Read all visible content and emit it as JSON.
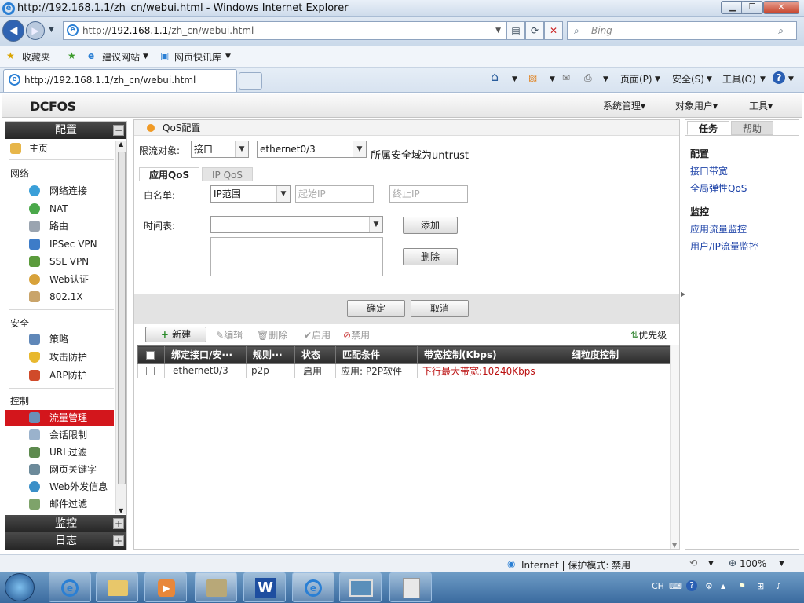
{
  "window": {
    "title": "http://192.168.1.1/zh_cn/webui.html - Windows Internet Explorer"
  },
  "address": {
    "prefix": "http://",
    "host": "192.168.1.1",
    "path": "/zh_cn/webui.html"
  },
  "search": {
    "placeholder": "Bing"
  },
  "favorites": {
    "label": "收藏夹",
    "items": [
      "建议网站",
      "网页快讯库"
    ]
  },
  "tab": {
    "title": "http://192.168.1.1/zh_cn/webui.html"
  },
  "commands": [
    "页面(P)",
    "安全(S)",
    "工具(O)"
  ],
  "app": {
    "logo": "DCFOS",
    "top_menu": [
      "系统管理",
      "对象用户",
      "工具"
    ]
  },
  "sidebar": {
    "header": "配置",
    "home": "主页",
    "sections": [
      {
        "title": "网络",
        "items": [
          "网络连接",
          "NAT",
          "路由",
          "IPSec VPN",
          "SSL VPN",
          "Web认证",
          "802.1X"
        ]
      },
      {
        "title": "安全",
        "items": [
          "策略",
          "攻击防护",
          "ARP防护"
        ]
      },
      {
        "title": "控制",
        "items": [
          "流量管理",
          "会话限制",
          "URL过滤",
          "网页关键字",
          "Web外发信息",
          "邮件过滤"
        ]
      }
    ],
    "selected": "流量管理",
    "footer": [
      "监控",
      "日志"
    ]
  },
  "main": {
    "title": "QoS配置",
    "limit_label": "限流对象:",
    "limit_type": "接口",
    "limit_iface": "ethernet0/3",
    "zone_note": "所属安全域为untrust",
    "tabs": [
      "应用QoS",
      "IP QoS"
    ],
    "whitelist_label": "白名单:",
    "whitelist_type": "IP范围",
    "start_ip_ph": "起始IP",
    "end_ip_ph": "终止IP",
    "schedule_label": "时间表:",
    "schedule_value": "",
    "add_label": "添加",
    "delete_label": "删除",
    "ok_label": "确定",
    "cancel_label": "取消",
    "toolbar": {
      "new": "新建",
      "edit": "编辑",
      "delete": "删除",
      "enable": "启用",
      "disable": "禁用",
      "priority": "优先级"
    },
    "columns": [
      "绑定接口/安···",
      "规则···",
      "状态",
      "匹配条件",
      "带宽控制(Kbps)",
      "细粒度控制"
    ],
    "rows": [
      {
        "iface": "ethernet0/3",
        "rule": "p2p",
        "status": "启用",
        "match": "应用: P2P软件",
        "bandwidth": "下行最大带宽:10240Kbps",
        "fine": ""
      }
    ]
  },
  "right_panel": {
    "tabs": [
      "任务",
      "帮助"
    ],
    "config_title": "配置",
    "config_links": [
      "接口带宽",
      "全局弹性QoS"
    ],
    "monitor_title": "监控",
    "monitor_links": [
      "应用流量监控",
      "用户/IP流量监控"
    ]
  },
  "status": {
    "zone": "Internet | 保护模式: 禁用",
    "zoom": "100%"
  },
  "tray": {
    "lang": "CH"
  }
}
